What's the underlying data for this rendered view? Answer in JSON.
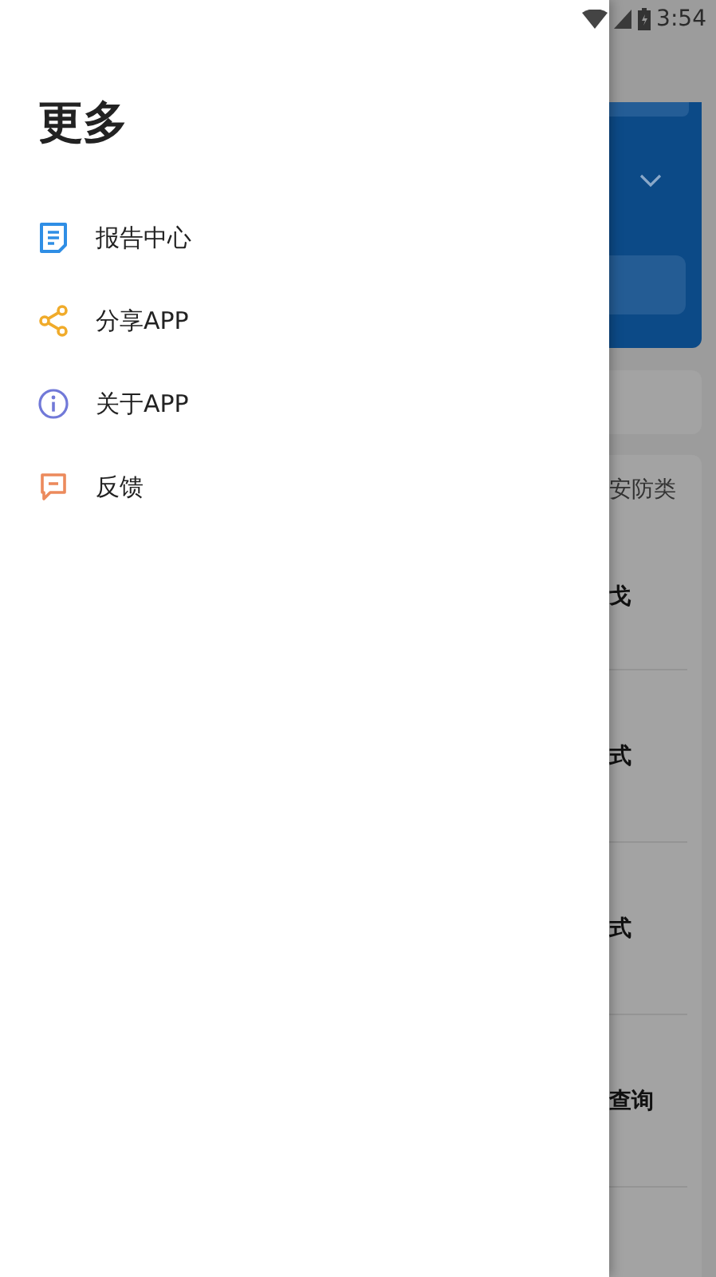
{
  "status_bar": {
    "time": "3:54"
  },
  "drawer": {
    "title": "更多",
    "items": [
      {
        "label": "报告中心",
        "kind": "document",
        "color": "#2f8ee5"
      },
      {
        "label": "分享APP",
        "kind": "share",
        "color": "#f0ab2a"
      },
      {
        "label": "关于APP",
        "kind": "info",
        "color": "#7179d8"
      },
      {
        "label": "反馈",
        "kind": "chat",
        "color": "#ec8a5c"
      }
    ]
  },
  "background": {
    "category_tab": "安防类",
    "rows": [
      {
        "label": "戈"
      },
      {
        "label": "式"
      },
      {
        "label": "式"
      },
      {
        "label": "查询"
      }
    ]
  }
}
